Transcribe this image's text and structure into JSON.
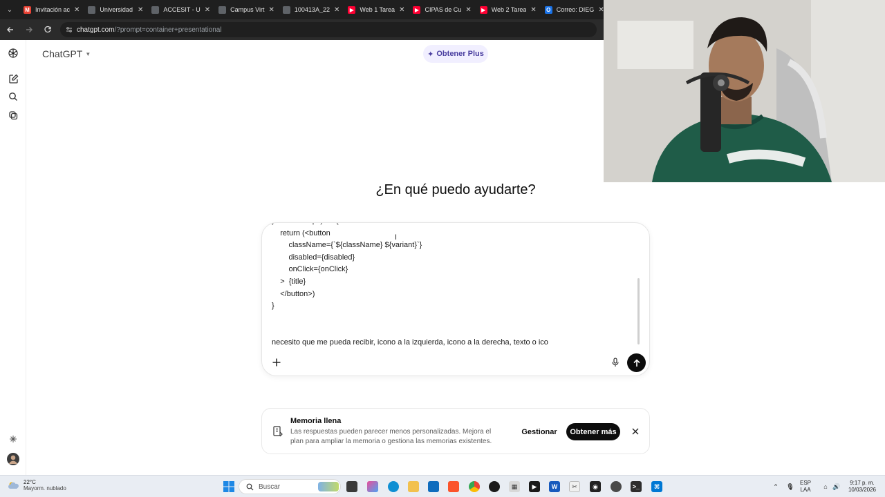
{
  "browser": {
    "tabs": [
      {
        "title": "Invitación ac",
        "icon": "gmail-icon",
        "color": "#ea4335",
        "glyph": "M"
      },
      {
        "title": "Universidad",
        "icon": "page-icon",
        "color": "#5f6368",
        "glyph": ""
      },
      {
        "title": "ACCESIT - U",
        "icon": "page-icon",
        "color": "#5f6368",
        "glyph": ""
      },
      {
        "title": "Campus Virt",
        "icon": "page-icon",
        "color": "#5f6368",
        "glyph": ""
      },
      {
        "title": "100413A_22",
        "icon": "page-icon",
        "color": "#5f6368",
        "glyph": ""
      },
      {
        "title": "Web 1 Tarea",
        "icon": "youtube-icon",
        "color": "#ff0033",
        "glyph": "▶"
      },
      {
        "title": "CIPAS de Cu",
        "icon": "youtube-icon",
        "color": "#ff0033",
        "glyph": "▶"
      },
      {
        "title": "Web 2 Tarea",
        "icon": "youtube-icon",
        "color": "#ff0033",
        "glyph": "▶"
      },
      {
        "title": "Correo: DIEG",
        "icon": "outlook-icon",
        "color": "#1a73e8",
        "glyph": "O"
      }
    ],
    "url_host": "chatgpt.com",
    "url_path": "/?prompt=container+presentational"
  },
  "header": {
    "title": "ChatGPT",
    "upgrade_label": "Obtener Plus"
  },
  "main": {
    "headline": "¿En qué puedo ayudarte?"
  },
  "composer": {
    "code_lines": [
      "}: ButtonProps) => {",
      "    return (<button",
      "        className={`${className} ${variant}`}",
      "        disabled={disabled}",
      "        onClick={onClick}",
      "    >  {title}",
      "    </button>)",
      "}",
      "",
      "",
      "necesito que me pueda recibir, icono a la izquierda, icono a la derecha, texto o ico"
    ]
  },
  "memory": {
    "title": "Memoria llena",
    "description": "Las respuestas pueden parecer menos personalizadas. Mejora el plan para ampliar la memoria o gestiona las memorias existentes.",
    "manage_label": "Gestionar",
    "more_label": "Obtener más"
  },
  "taskbar": {
    "weather_temp": "22°C",
    "weather_condition": "Mayorm. nublado",
    "search_placeholder": "Buscar",
    "lang_top": "ESP",
    "lang_bottom": "LAA",
    "time": "9:17 p. m.",
    "date": "10/03/2026"
  }
}
